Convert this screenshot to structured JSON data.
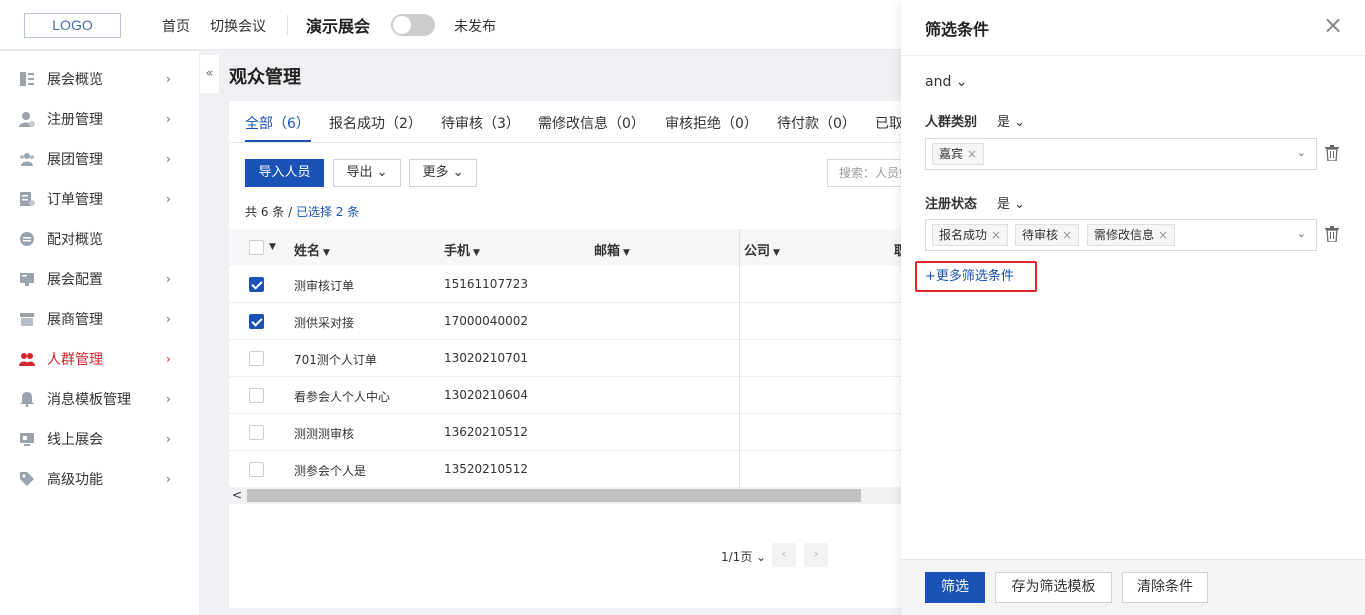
{
  "header": {
    "logo": "LOGO",
    "nav": [
      "首页",
      "切换会议"
    ],
    "meeting_title": "演示展会",
    "publish_status": "未发布"
  },
  "sidebar": {
    "collapse": "«",
    "items": [
      {
        "label": "展会概览",
        "icon": "overview-icon",
        "arrow": "›"
      },
      {
        "label": "注册管理",
        "icon": "user-register-icon",
        "arrow": "›"
      },
      {
        "label": "展团管理",
        "icon": "group-icon",
        "arrow": "›"
      },
      {
        "label": "订单管理",
        "icon": "order-icon",
        "arrow": "›"
      },
      {
        "label": "配对概览",
        "icon": "match-icon",
        "arrow": ""
      },
      {
        "label": "展会配置",
        "icon": "config-icon",
        "arrow": "›"
      },
      {
        "label": "展商管理",
        "icon": "exhibitor-icon",
        "arrow": "›"
      },
      {
        "label": "人群管理",
        "icon": "crowd-icon",
        "arrow": "›",
        "active": true
      },
      {
        "label": "消息模板管理",
        "icon": "bell-icon",
        "arrow": "›"
      },
      {
        "label": "线上展会",
        "icon": "online-icon",
        "arrow": "›"
      },
      {
        "label": "高级功能",
        "icon": "tag-icon",
        "arrow": "›"
      }
    ]
  },
  "main": {
    "title": "观众管理",
    "tabs": [
      "全部（6）",
      "报名成功（2）",
      "待审核（3）",
      "需修改信息（0）",
      "审核拒绝（0）",
      "待付款（0）",
      "已取消"
    ],
    "toolbar": {
      "import": "导入人员",
      "export": "导出",
      "more": "更多",
      "search_placeholder": "搜索：人员姓名"
    },
    "count_prefix": "共 6 条 / ",
    "count_selected": "已选择 2 条",
    "columns": [
      "姓名",
      "手机",
      "邮箱",
      "公司",
      "职"
    ],
    "rows": [
      {
        "name": "测审核订单",
        "phone": "15161107723",
        "checked": true
      },
      {
        "name": "测供采对接",
        "phone": "17000040002",
        "checked": true
      },
      {
        "name": "701测个人订单",
        "phone": "13020210701",
        "checked": false
      },
      {
        "name": "看参会人个人中心",
        "phone": "13020210604",
        "checked": false
      },
      {
        "name": "测测测审核",
        "phone": "13620210512",
        "checked": false
      },
      {
        "name": "测参会个人是",
        "phone": "13520210512",
        "checked": false
      }
    ],
    "pager": {
      "text": "1/1页",
      "prev": "‹",
      "next": "›"
    }
  },
  "drawer": {
    "title": "筛选条件",
    "close": "×",
    "logic": "and",
    "filters": [
      {
        "label": "人群类别",
        "op": "是",
        "tags": [
          "嘉宾"
        ]
      },
      {
        "label": "注册状态",
        "op": "是",
        "tags": [
          "报名成功",
          "待审核",
          "需修改信息"
        ]
      }
    ],
    "more_filter": "更多筛选条件",
    "footer": {
      "apply": "筛选",
      "save_template": "存为筛选模板",
      "clear": "清除条件"
    }
  },
  "colors": {
    "accent": "#1a52b5",
    "active_nav": "#d4262c",
    "highlight_border": "#e0252b"
  }
}
